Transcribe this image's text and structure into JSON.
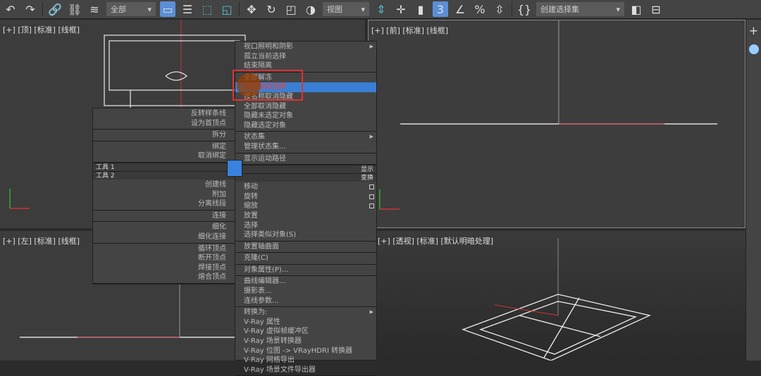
{
  "toolbar": {
    "selection_filter": "全部",
    "view_dropdown": "视图",
    "named_selection": "创建选择集",
    "icons": [
      "undo-icon",
      "redo-icon",
      "link-icon",
      "unlink-icon",
      "bind-space-warp-icon",
      "select-object-icon",
      "select-by-name-icon",
      "rect-region-icon",
      "window-crossing-icon",
      "move-icon",
      "rotate-icon",
      "scale-icon",
      "placement-icon",
      "pivot-icon",
      "mirror-icon",
      "snap-3d-icon",
      "angle-snap-icon",
      "percent-snap-icon",
      "spinner-snap-icon",
      "edit-named-sel-icon"
    ]
  },
  "viewports": {
    "top": "[+] [顶] [标准] [线框]",
    "front": "[+] [前] [标准] [线框]",
    "left": "[+] [左] [标准] [线框]",
    "perspective": "[+] [透视] [标准] [默认明暗处理]"
  },
  "right_quad": {
    "display_groups": [
      [
        "视口照明和阴影",
        "孤立当前选择",
        "结束隔离"
      ],
      [
        "全部解冻",
        "冻结当前选择",
        "按名称取消隐藏",
        "全部取消隐藏",
        "隐藏未选定对象",
        "隐藏选定对象"
      ],
      [
        "状态集",
        "管理状态集..."
      ],
      [
        "显示运动路径"
      ]
    ],
    "display_label": "显示",
    "transform_label": "变换",
    "transform_groups": [
      [
        "移动",
        "旋转",
        "缩放",
        "放置",
        "选择",
        "选择类似对象(S)"
      ],
      [
        "放置轴曲面"
      ],
      [
        "克隆(C)"
      ],
      [
        "对象属性(P)..."
      ],
      [
        "曲线编辑器...",
        "摄影表...",
        "连线参数..."
      ],
      [
        "转换为:",
        "V-Ray 属性",
        "V-Ray 虚拟帧缓冲区",
        "V-Ray 场景转换器",
        "V-Ray 位图 -> VRayHDRI 转换器",
        "V-Ray 网格导出",
        "V-Ray 场景文件导出器"
      ]
    ],
    "highlighted": "冻结当前选择"
  },
  "left_quad": {
    "tools1_groups": [
      [
        "反转样条线",
        "设为首顶点"
      ],
      [
        "拆分"
      ],
      [
        "绑定",
        "取消绑定"
      ]
    ],
    "tools1_label": "工具 1",
    "tools2_label": "工具 2",
    "tools2_groups": [
      [
        "创建线",
        "附加",
        "分离线段"
      ],
      [
        "连接"
      ],
      [
        "细化",
        "细化连接"
      ],
      [
        "循环顶点",
        "断开顶点",
        "焊接顶点",
        "熔合顶点"
      ]
    ]
  },
  "colors": {
    "highlight": "#3a7fd5",
    "annotation": "#e03030"
  }
}
